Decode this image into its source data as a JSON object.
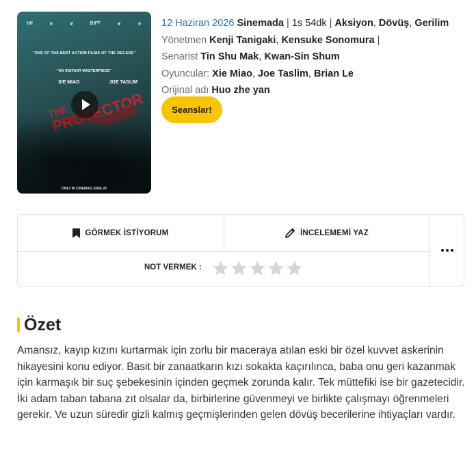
{
  "poster": {
    "festivals": [
      "tiff",
      "",
      "",
      "BIFF",
      "",
      ""
    ],
    "quote1": "\"ONE OF THE BEST ACTION FILMS OF THE DECADE\"",
    "quote2": "\"AN INSTANT MASTERPIECE\"",
    "name_left": "XIE MIAO",
    "name_right": "JOE TASLIM",
    "title_art": "THE PROTECTOR",
    "bottom": "ONLY IN CINEMAS JUNE 26"
  },
  "meta": {
    "date": "12 Haziran 2026",
    "status": "Sinemada",
    "duration": "1s 54dk",
    "genres": [
      "Aksiyon",
      "Dövüş",
      "Gerilim"
    ],
    "director_label": "Yönetmen",
    "directors": [
      "Kenji Tanigaki",
      "Kensuke Sonomura"
    ],
    "writer_label": "Senarist",
    "writers": [
      "Tin Shu Mak",
      "Kwan-Sin Shum"
    ],
    "cast_label": "Oyuncular:",
    "cast": [
      "Xie Miao",
      "Joe Taslim",
      "Brian Le"
    ],
    "original_label": "Orijinal adı",
    "original_title": "Huo zhe yan"
  },
  "buttons": {
    "seanslar": "Seanslar!",
    "watchlist": "GÖRMEK İSTİYORUM",
    "review": "İNCELEMEMİ YAZ"
  },
  "rating": {
    "label": "NOT VERMEK :",
    "stars_total": 5,
    "stars_filled": 0
  },
  "summary": {
    "title": "Özet",
    "text": "Amansız, kayıp kızını kurtarmak için zorlu bir maceraya atılan eski bir özel kuvvet askerinin hikayesini konu ediyor. Basit bir zanaatkarın kızı sokakta kaçırılınca, baba onu geri kazanmak için karmaşık bir suç şebekesinin içinden geçmek zorunda kalır. Tek müttefiki ise bir gazetecidir. İki adam taban tabana zıt olsalar da, birbirlerine güvenmeyi ve birlikte çalışmayı öğrenmeleri gerekir. Ve uzun süredir gizli kalmış geçmişlerinden gelen dövüş becerilerine ihtiyaçları vardır."
  },
  "colors": {
    "accent": "#f7c500",
    "link": "#2f6fa7",
    "star_empty": "#d6d6d6"
  }
}
